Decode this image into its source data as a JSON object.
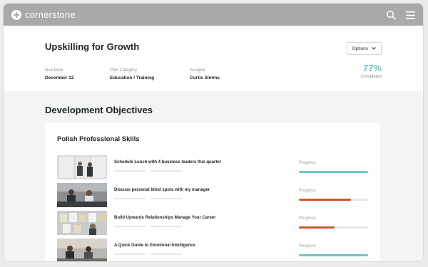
{
  "brand": {
    "name": "cornerstone"
  },
  "header": {
    "title": "Upskilling for Growth",
    "options_label": "Options",
    "meta": [
      {
        "label": "Due Date",
        "value": "December 12"
      },
      {
        "label": "Plan Category",
        "value": "Education / Training"
      },
      {
        "label": "Assigne",
        "value": "Curtis Simms"
      }
    ],
    "completion": {
      "value": "77%",
      "label": "Completed"
    }
  },
  "section": {
    "title": "Development Objectives"
  },
  "objective": {
    "title": "Polish Professional Skills",
    "progress_label": "Progress",
    "items": [
      {
        "title": "Schedule Lunch with 4 business leaders this quarter",
        "progress": 1.0,
        "color": "#74c4c6"
      },
      {
        "title": "Discuss personal blind spots with my manager",
        "progress": 0.75,
        "color": "#d0552d"
      },
      {
        "title": "Build Upwards Relationships Manage Your Career",
        "progress": 0.52,
        "color": "#d0552d"
      },
      {
        "title": "A Quick Guide to Emotional Intelligence",
        "progress": 1.0,
        "color": "#74c4c6"
      }
    ]
  },
  "colors": {
    "topbar": "#a7a9aa",
    "accent_teal": "#6cc2c5",
    "accent_orange": "#d0552d"
  },
  "icons": [
    "logo-mark-icon",
    "search-icon",
    "menu-icon",
    "chevron-down-icon"
  ]
}
